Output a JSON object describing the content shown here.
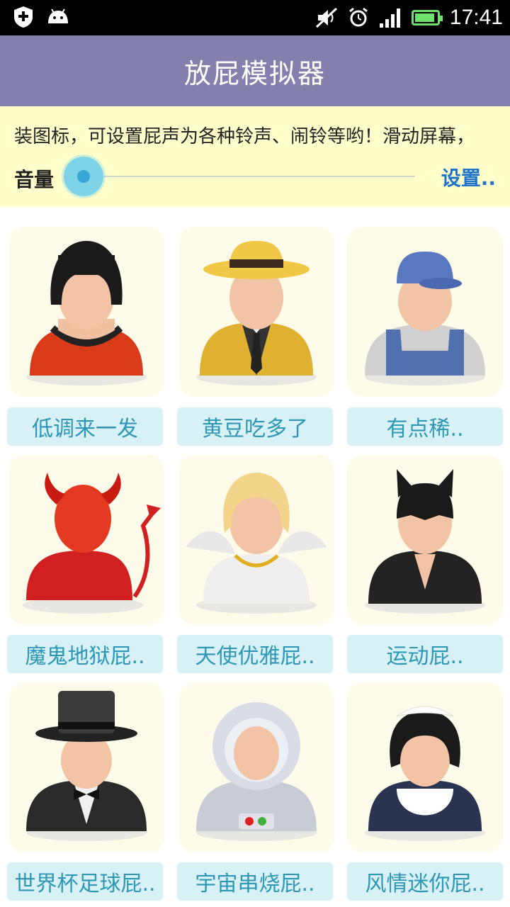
{
  "status_bar": {
    "time": "17:41",
    "left_icons": [
      "shield-plus-icon",
      "android-icon"
    ],
    "right_icons": [
      "mute-icon",
      "alarm-icon",
      "signal-icon",
      "battery-icon"
    ],
    "battery_level": 0.9
  },
  "app": {
    "title": "放屁模拟器"
  },
  "notice": {
    "marquee_text": "装图标，可设置屁声为各种铃声、闹铃等哟！滑动屏幕，",
    "volume_label": "音量",
    "volume_level": 0.0,
    "settings_label": "设置.."
  },
  "grid": {
    "items": [
      {
        "label": "",
        "icon": "partial-item-icon"
      },
      {
        "label": "",
        "icon": "partial-item-icon"
      },
      {
        "label": "",
        "icon": "partial-item-icon"
      },
      {
        "label": "低调来一发",
        "icon": "woman-bob-hair-icon"
      },
      {
        "label": "黄豆吃多了",
        "icon": "detective-fedora-icon"
      },
      {
        "label": "有点稀..",
        "icon": "worker-cap-overalls-icon"
      },
      {
        "label": "魔鬼地狱屁..",
        "icon": "devil-icon"
      },
      {
        "label": "天使优雅屁..",
        "icon": "angel-icon"
      },
      {
        "label": "运动屁..",
        "icon": "catwoman-mask-icon"
      },
      {
        "label": "世界杯足球屁..",
        "icon": "top-hat-gentleman-icon"
      },
      {
        "label": "宇宙串烧屁..",
        "icon": "astronaut-icon"
      },
      {
        "label": "风情迷你屁..",
        "icon": "maid-icon"
      }
    ]
  }
}
